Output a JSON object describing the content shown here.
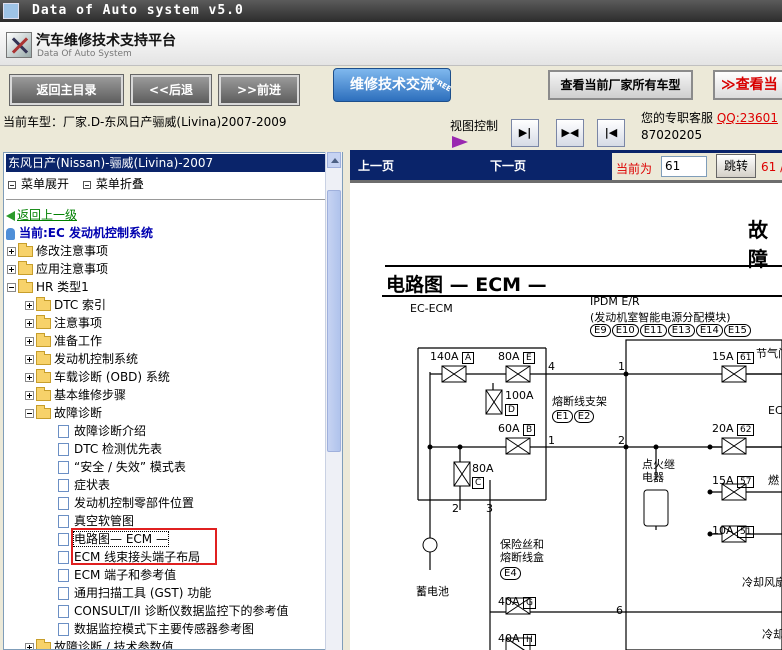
{
  "window": {
    "title": "Data of Auto system v5.0"
  },
  "header": {
    "title": "汽车维修技术支持平台",
    "subtitle": "Data Of Auto System"
  },
  "nav": {
    "home": "返回主目录",
    "back": "<<后退",
    "forward": ">>前进",
    "exchange": "维修技术交流",
    "free_badge": "FREE",
    "view_all_models": "查看当前厂家所有车型",
    "view_partial": "≫查看当"
  },
  "info": {
    "current_model": "当前车型：厂家.D-东风日产骊威(Livina)2007-2009",
    "view_control": "视图控制",
    "support_label": "您的专职客服",
    "qq": "QQ:23601",
    "phone": "87020205"
  },
  "left": {
    "header": "东风日产(Nissan)-骊威(Livina)-2007",
    "menu_expand": "菜单展开",
    "menu_collapse": "菜单折叠",
    "back_link": "返回上一级",
    "current_label": "当前:EC 发动机控制系统",
    "tree": [
      {
        "label": "修改注意事项"
      },
      {
        "label": "应用注意事项"
      },
      {
        "label": "HR 类型1"
      },
      {
        "label": "DTC 索引"
      },
      {
        "label": "注意事项"
      },
      {
        "label": "准备工作"
      },
      {
        "label": "发动机控制系统"
      },
      {
        "label": "车载诊断 (OBD) 系统"
      },
      {
        "label": "基本维修步骤"
      },
      {
        "label": "故障诊断"
      },
      {
        "label": "故障诊断介绍"
      },
      {
        "label": "DTC 检测优先表"
      },
      {
        "label": "“安全 / 失效” 模式表"
      },
      {
        "label": "症状表"
      },
      {
        "label": "发动机控制零部件位置"
      },
      {
        "label": "真空软管图"
      },
      {
        "label": "电路图— ECM —"
      },
      {
        "label": "ECM 线束接头端子布局"
      },
      {
        "label": "ECM 端子和参考值"
      },
      {
        "label": "通用扫描工具 (GST) 功能"
      },
      {
        "label": "CONSULT/II 诊断仪数据监控下的参考值"
      },
      {
        "label": "数据监控模式下主要传感器参考图"
      },
      {
        "label": "故障诊断 / 技术参数值"
      }
    ]
  },
  "right": {
    "prev": "上一页",
    "next": "下一页",
    "current_label": "当前为",
    "page_value": "61",
    "jump": "跳转",
    "total": "61 /",
    "diagram": {
      "heading_right": "故障",
      "title": "电路图 — ECM —",
      "ec_ecm": "EC-ECM",
      "ipdm": "IPDM E/R",
      "ipdm_desc": "(发动机室智能电源分配模块)",
      "ipdm_conn": [
        "E9",
        "E10",
        "E11",
        "E13",
        "E14",
        "E15"
      ],
      "fuse_labels": [
        "140A",
        "A",
        "80A",
        "E",
        "100A",
        "D",
        "60A",
        "B",
        "80A",
        "C",
        "15A",
        "61",
        "20A",
        "62",
        "15A",
        "57",
        "10A",
        "51",
        "40A",
        "G",
        "40A",
        "H"
      ],
      "fuse_bracket": "熔断线支架",
      "fuse_bracket_conn": [
        "E1",
        "E2"
      ],
      "ignition_relay": "点火继电器",
      "fuse_box": "保险丝和熔断线盒",
      "fuse_box_conn": "E4",
      "battery": "蓄电池",
      "throttle": "节气门",
      "cooling_fan": "冷却风扇",
      "cooling_fan2": "冷却",
      "fuel": "燃",
      "ec": "EC",
      "wire_numbers": [
        "4",
        "1",
        "1",
        "2",
        "2",
        "3",
        "6"
      ]
    }
  }
}
